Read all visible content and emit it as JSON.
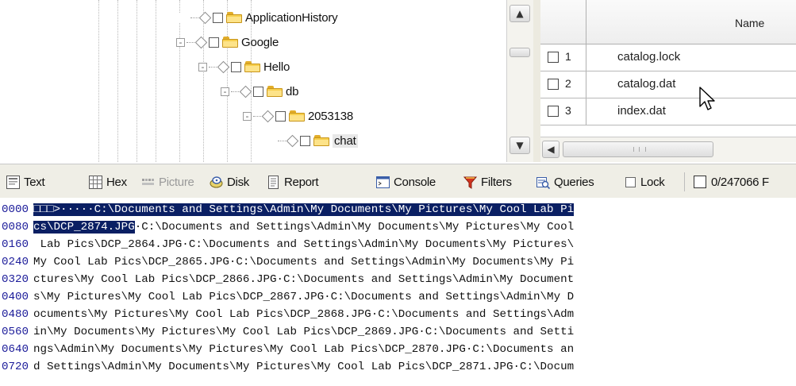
{
  "tree": {
    "nodes": [
      {
        "label": "ApplicationHistory",
        "expander": ""
      },
      {
        "label": "Google",
        "expander": "-"
      },
      {
        "label": "Hello",
        "expander": "-"
      },
      {
        "label": "db",
        "expander": "-"
      },
      {
        "label": "2053138",
        "expander": "-"
      },
      {
        "label": "chat",
        "expander": ""
      }
    ]
  },
  "grid": {
    "column_name": "Name",
    "rows": [
      {
        "num": "1",
        "name": "catalog.lock"
      },
      {
        "num": "2",
        "name": "catalog.dat"
      },
      {
        "num": "3",
        "name": "index.dat"
      }
    ]
  },
  "toolbar": {
    "text": "Text",
    "hex": "Hex",
    "picture": "Picture",
    "disk": "Disk",
    "report": "Report",
    "console": "Console",
    "filters": "Filters",
    "queries": "Queries",
    "lock": "Lock",
    "counter": "0/247066 F"
  },
  "hex": {
    "lines": [
      {
        "offset": "0000",
        "sel": "□□□>·····C:\\Documents and Settings\\Admin\\My Documents\\My Pictures\\My Cool Lab Pi",
        "rest": ""
      },
      {
        "offset": "0080",
        "sel": "cs\\DCP_2874.JPG",
        "rest": "·C:\\Documents and Settings\\Admin\\My Documents\\My Pictures\\My Cool"
      },
      {
        "offset": "0160",
        "sel": "",
        "rest": " Lab Pics\\DCP_2864.JPG·C:\\Documents and Settings\\Admin\\My Documents\\My Pictures\\"
      },
      {
        "offset": "0240",
        "sel": "",
        "rest": "My Cool Lab Pics\\DCP_2865.JPG·C:\\Documents and Settings\\Admin\\My Documents\\My Pi"
      },
      {
        "offset": "0320",
        "sel": "",
        "rest": "ctures\\My Cool Lab Pics\\DCP_2866.JPG·C:\\Documents and Settings\\Admin\\My Document"
      },
      {
        "offset": "0400",
        "sel": "",
        "rest": "s\\My Pictures\\My Cool Lab Pics\\DCP_2867.JPG·C:\\Documents and Settings\\Admin\\My D"
      },
      {
        "offset": "0480",
        "sel": "",
        "rest": "ocuments\\My Pictures\\My Cool Lab Pics\\DCP_2868.JPG·C:\\Documents and Settings\\Adm"
      },
      {
        "offset": "0560",
        "sel": "",
        "rest": "in\\My Documents\\My Pictures\\My Cool Lab Pics\\DCP_2869.JPG·C:\\Documents and Setti"
      },
      {
        "offset": "0640",
        "sel": "",
        "rest": "ngs\\Admin\\My Documents\\My Pictures\\My Cool Lab Pics\\DCP_2870.JPG·C:\\Documents an"
      },
      {
        "offset": "0720",
        "sel": "",
        "rest": "d Settings\\Admin\\My Documents\\My Pictures\\My Cool Lab Pics\\DCP_2871.JPG·C:\\Docum"
      }
    ]
  },
  "colors": {
    "selection_bg": "#0a1f63",
    "offset_text": "#1c1c9a",
    "toolbar_bg": "#efeee6"
  },
  "icons": [
    "text-view-icon",
    "hex-view-icon",
    "picture-icon",
    "disk-icon",
    "report-icon",
    "console-icon",
    "filters-icon",
    "queries-icon",
    "scroll-up-icon",
    "scroll-down-icon",
    "scroll-left-icon",
    "mouse-pointer-icon"
  ]
}
